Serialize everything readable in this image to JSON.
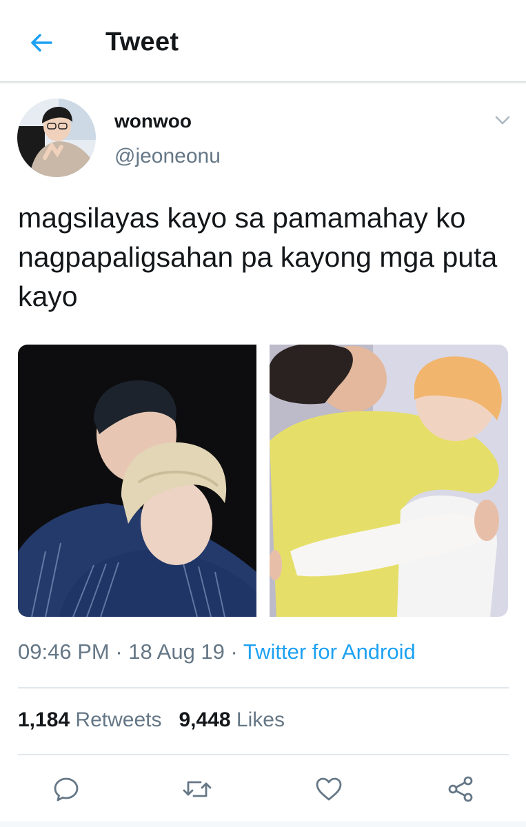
{
  "header": {
    "title": "Tweet"
  },
  "tweet": {
    "author_name": "wonwoo",
    "author_handle": "@jeoneonu",
    "text": "magsilayas kayo sa pamamahay ko nagpapaligsahan pa kayong mga puta kayo",
    "time": "09:46 PM",
    "date": "18 Aug 19",
    "separator": " · ",
    "source": "Twitter for Android"
  },
  "stats": {
    "retweets_count": "1,184",
    "retweets_label": "Retweets",
    "likes_count": "9,448",
    "likes_label": "Likes"
  },
  "icons": {
    "back": "arrow-left-icon",
    "more": "chevron-down-icon",
    "reply": "reply-icon",
    "retweet": "retweet-icon",
    "like": "heart-icon",
    "share": "share-icon"
  },
  "colors": {
    "accent": "#1da1f2",
    "text": "#14171a",
    "muted": "#657786",
    "divider": "#e1e8ed"
  }
}
